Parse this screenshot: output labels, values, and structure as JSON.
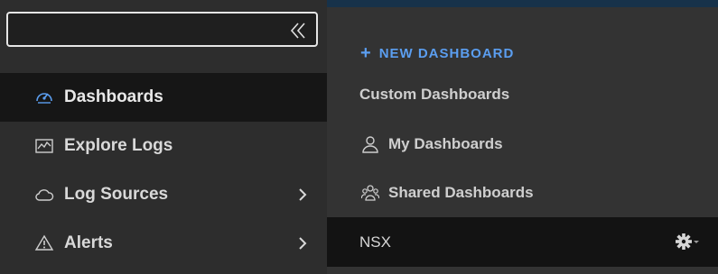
{
  "search": {
    "value": "",
    "placeholder": ""
  },
  "sidebar": {
    "items": [
      {
        "label": "Dashboards",
        "icon": "speedometer-icon",
        "active": true,
        "has_submenu": false
      },
      {
        "label": "Explore Logs",
        "icon": "chart-line-icon",
        "active": false,
        "has_submenu": false
      },
      {
        "label": "Log Sources",
        "icon": "cloud-icon",
        "active": false,
        "has_submenu": true
      },
      {
        "label": "Alerts",
        "icon": "warning-icon",
        "active": false,
        "has_submenu": true
      }
    ]
  },
  "panel": {
    "new_dashboard_label": "+ NEW DASHBOARD",
    "new_dashboard_text": "NEW DASHBOARD",
    "new_dashboard_plus": "+",
    "section_label": "Custom Dashboards",
    "items": [
      {
        "label": "My Dashboards",
        "icon": "user-icon"
      },
      {
        "label": "Shared Dashboards",
        "icon": "users-icon"
      }
    ],
    "selected_dashboard": {
      "label": "NSX",
      "icon": "gear-icon"
    }
  },
  "colors": {
    "accent": "#5b9ef0",
    "sidebar_bg": "#2d2d2d",
    "active_bg": "#161616",
    "panel_bg": "#333333",
    "selected_bg": "#131313",
    "top_strip": "#17324a"
  }
}
